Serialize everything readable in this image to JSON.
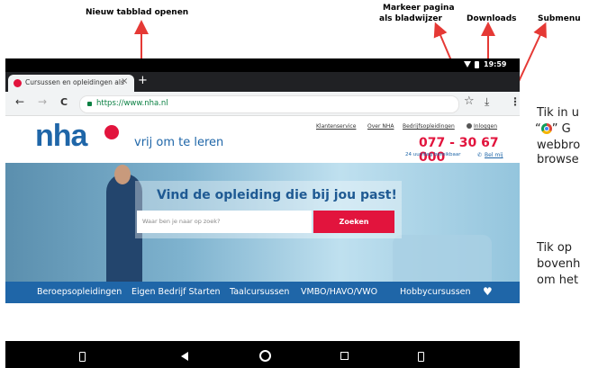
{
  "callouts": {
    "new_tab": "Nieuw tabblad openen",
    "bookmark_line1": "Markeer pagina",
    "bookmark_line2": "als bladwijzer",
    "downloads": "Downloads",
    "submenu": "Submenu"
  },
  "side_text": {
    "line1": "Tik in u",
    "line2a": "“",
    "line2b": "” G",
    "line3": "webbro",
    "line4": "browse",
    "line5": "Tik op",
    "line6": "bovenh",
    "line7": "om het"
  },
  "status_bar": {
    "time": "19:59"
  },
  "tab": {
    "title": "Cursussen en opleidingen als",
    "close": "×",
    "new_tab": "+"
  },
  "toolbar": {
    "url": "https://www.nha.nl",
    "back": "←",
    "forward": "→",
    "reload": "C"
  },
  "header": {
    "logo": "nha",
    "tagline": "vrij om te leren",
    "links": [
      "Klantenservice",
      "Over NHA",
      "Bedrijfsopleidingen",
      "Inloggen"
    ],
    "phone": "077 - 30 67 000",
    "phone_note": "24 uur/dag bereikbaar",
    "call_link": "Bel mij"
  },
  "hero": {
    "heading": "Vind de opleiding die bij jou past!",
    "search_placeholder": "Waar ben je naar op zoek?",
    "search_button": "Zoeken"
  },
  "nav": {
    "items": [
      "Beroepsopleidingen",
      "Eigen Bedrijf Starten",
      "Taalcursussen",
      "VMBO/HAVO/VWO",
      "Hobbycursussen"
    ],
    "favorite_icon": "♥"
  },
  "colors": {
    "brand_blue": "#1f66a8",
    "accent_red": "#e2143d",
    "callout_arrow": "#e53935"
  }
}
